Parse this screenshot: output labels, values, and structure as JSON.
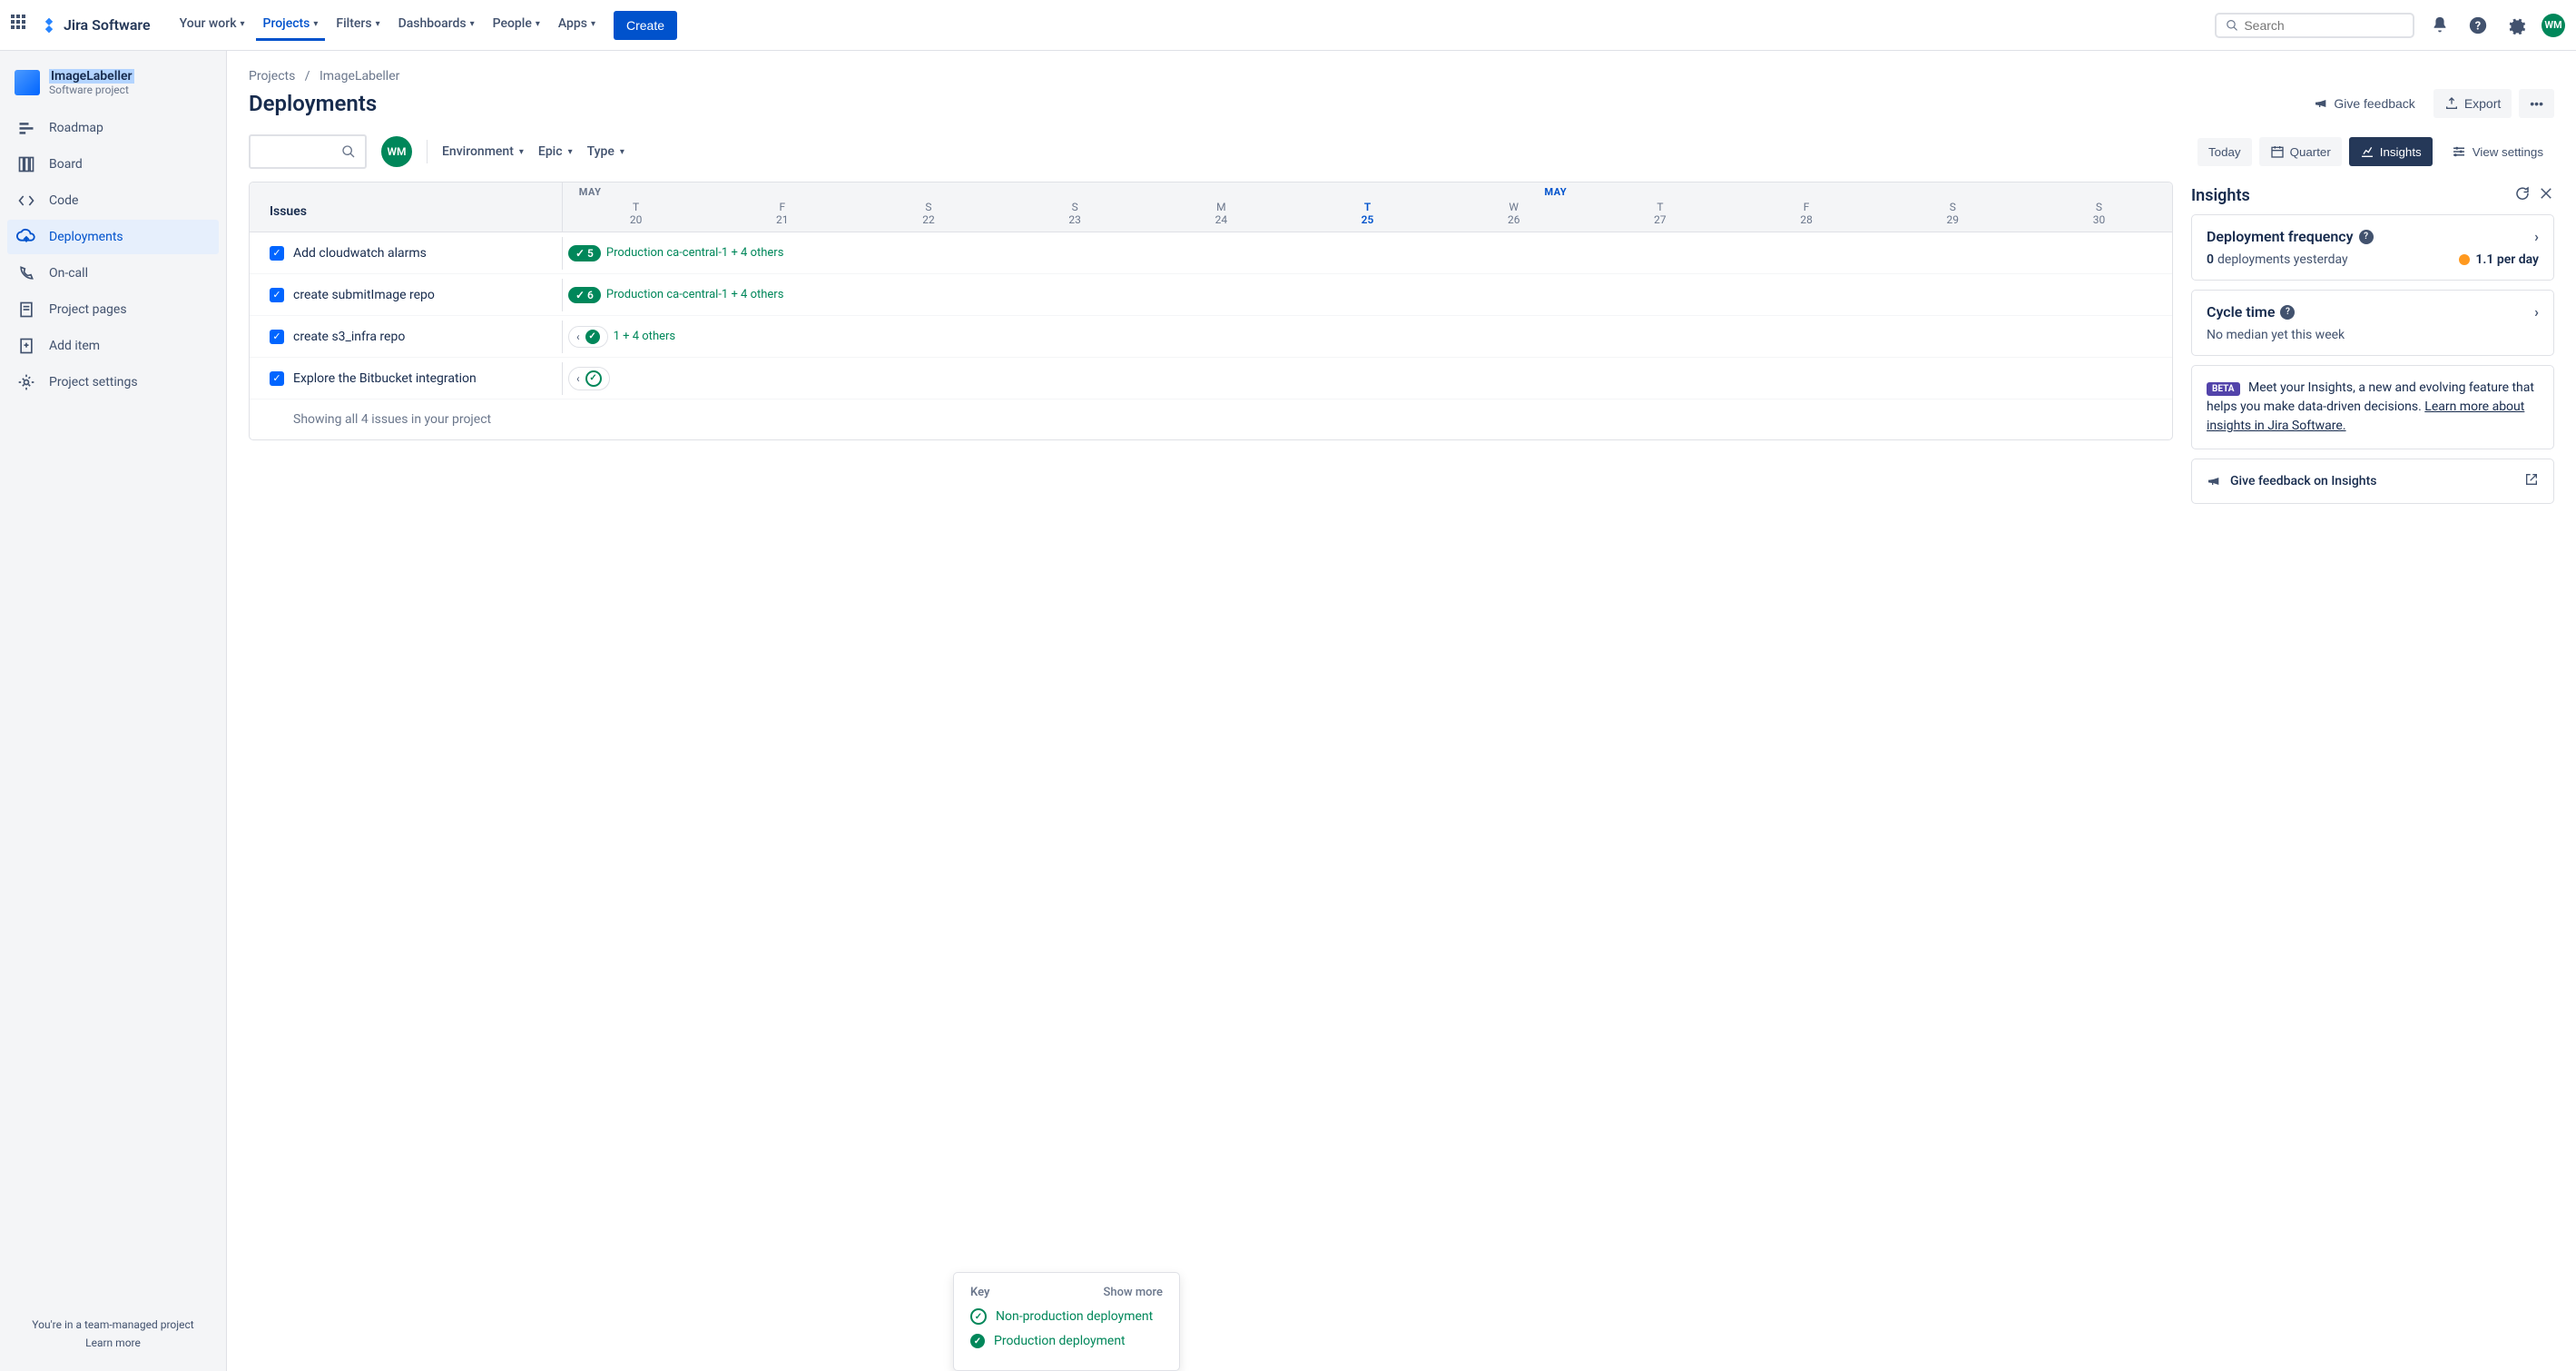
{
  "topbar": {
    "product": "Jira Software",
    "nav": [
      "Your work",
      "Projects",
      "Filters",
      "Dashboards",
      "People",
      "Apps"
    ],
    "active_nav_index": 1,
    "create": "Create",
    "search_placeholder": "Search",
    "avatar_initials": "WM"
  },
  "sidebar": {
    "project_name": "ImageLabeller",
    "project_type": "Software project",
    "items": [
      "Roadmap",
      "Board",
      "Code",
      "Deployments",
      "On-call",
      "Project pages",
      "Add item",
      "Project settings"
    ],
    "active_index": 3,
    "footer_text": "You're in a team-managed project",
    "footer_link": "Learn more"
  },
  "breadcrumb": {
    "parent": "Projects",
    "current": "ImageLabeller"
  },
  "page": {
    "title": "Deployments",
    "feedback": "Give feedback",
    "export": "Export"
  },
  "filters": {
    "avatar_initials": "WM",
    "dropdowns": [
      "Environment",
      "Epic",
      "Type"
    ],
    "today": "Today",
    "quarter": "Quarter",
    "insights": "Insights",
    "view_settings": "View settings"
  },
  "timeline": {
    "issues_header": "Issues",
    "months": [
      {
        "label": "MAY",
        "offset_pct": 1,
        "active": false
      },
      {
        "label": "MAY",
        "offset_pct": 61,
        "active": true
      }
    ],
    "dates": [
      {
        "dow": "T",
        "day": "20"
      },
      {
        "dow": "F",
        "day": "21"
      },
      {
        "dow": "S",
        "day": "22"
      },
      {
        "dow": "S",
        "day": "23"
      },
      {
        "dow": "M",
        "day": "24"
      },
      {
        "dow": "T",
        "day": "25",
        "active": true
      },
      {
        "dow": "W",
        "day": "26"
      },
      {
        "dow": "T",
        "day": "27"
      },
      {
        "dow": "F",
        "day": "28"
      },
      {
        "dow": "S",
        "day": "29"
      },
      {
        "dow": "S",
        "day": "30"
      }
    ],
    "rows": [
      {
        "title": "Add cloudwatch alarms",
        "badge_count": "5",
        "text": "Production ca-central-1 + 4 others",
        "style": "badge"
      },
      {
        "title": "create submitImage repo",
        "badge_count": "6",
        "text": "Production ca-central-1 + 4 others",
        "style": "badge"
      },
      {
        "title": "create s3_infra repo",
        "text": "1 + 4 others",
        "style": "chip"
      },
      {
        "title": "Explore the Bitbucket integration",
        "style": "chip-only"
      }
    ],
    "footer": "Showing all 4 issues in your project"
  },
  "insights": {
    "title": "Insights",
    "freq": {
      "title": "Deployment frequency",
      "value": "0",
      "label": "deployments yesterday",
      "stat": "1.1 per day"
    },
    "cycle": {
      "title": "Cycle time",
      "body": "No median yet this week"
    },
    "beta": {
      "badge": "BETA",
      "text": "Meet your Insights, a new and evolving feature that helps you make data-driven decisions.",
      "link": "Learn more about insights in Jira Software."
    },
    "feedback": "Give feedback on Insights"
  },
  "key": {
    "title": "Key",
    "more": "Show more",
    "items": [
      "Non-production deployment",
      "Production deployment"
    ]
  }
}
